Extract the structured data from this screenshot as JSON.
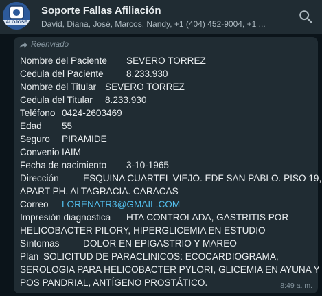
{
  "chat": {
    "title": "Soporte Fallas Afiliación",
    "participants": "David, Diana, José, Marcos, Nandy, +1 (404) 452-9004, +1 ...",
    "avatar_text": "ALOJOSE"
  },
  "message": {
    "forwarded_label": "Reenviado",
    "time": "8:49 a. m.",
    "fields": [
      {
        "label": "Nombre del Paciente",
        "value": "SEVERO TORREZ"
      },
      {
        "label": "Cedula del Paciente",
        "value": "8.233.930"
      },
      {
        "label": "Nombre del Titular",
        "value": "SEVERO TORREZ"
      },
      {
        "label": "Cedula del Titular",
        "value": "8.233.930"
      },
      {
        "label": "Teléfono",
        "value": "0424-2603469"
      },
      {
        "label": "Edad",
        "value": "55"
      },
      {
        "label": "Seguro",
        "value": "PIRAMIDE"
      },
      {
        "label": "Convenio",
        "value": "IAIM"
      },
      {
        "label": "Fecha de nacimiento",
        "value": "3-10-1965"
      },
      {
        "label": "Dirección",
        "value": "ESQUINA CUARTEL VIEJO. EDF SAN PABLO. PISO 19,"
      },
      {
        "label": "",
        "value": "APART PH. ALTAGRACIA. CARACAS"
      },
      {
        "label": "Correo",
        "value": "LORENATR3@GMAIL.COM"
      },
      {
        "label": "Impresión diagnostica",
        "value": "HTA CONTROLADA, GASTRITIS POR"
      },
      {
        "label": "",
        "value": "HELICOBACTER PILORY, HIPERGLICEMIA EN ESTUDIO"
      },
      {
        "label": "Síntomas",
        "value": "DOLOR EN EPIGASTRIO Y MAREO"
      },
      {
        "label": "Plan",
        "value": "SOLICITUD DE PARACLINICOS: ECOCARDIOGRAMA,"
      },
      {
        "label": "",
        "value": "SEROLOGIA PARA HELICOBACTER PYLORI, GLICEMIA EN AYUNA Y"
      },
      {
        "label": "",
        "value": "POS PANDRIAL, ANTÍGENO PROSTÁTICO."
      }
    ]
  }
}
